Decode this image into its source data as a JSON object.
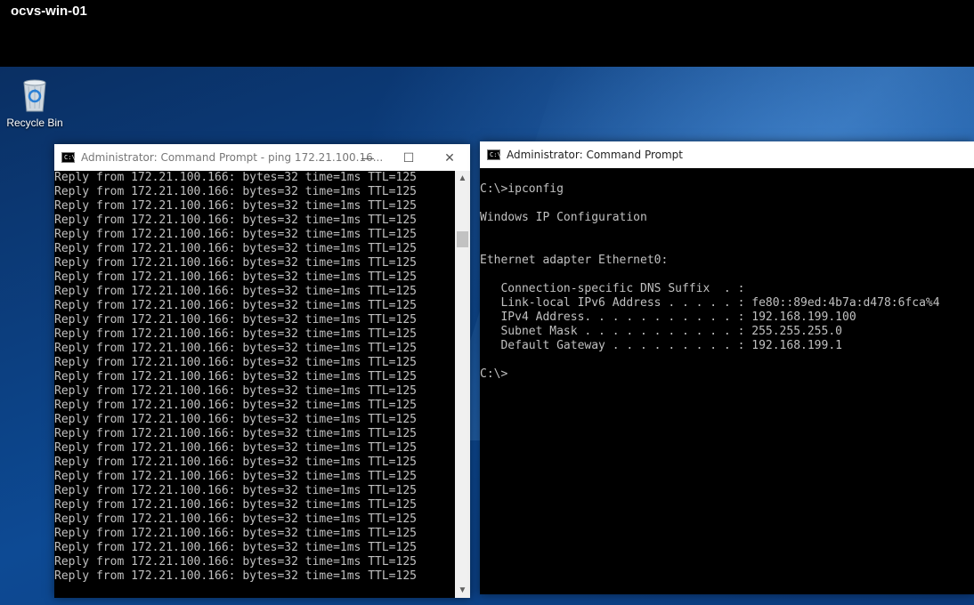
{
  "vm": {
    "name": "ocvs-win-01"
  },
  "desktop": {
    "recycle_bin": {
      "label": "Recycle Bin",
      "icon": "recycle-bin-icon"
    }
  },
  "ping_window": {
    "title": "Administrator: Command Prompt - ping  172.21.100.16...",
    "line_text": "Reply from 172.21.100.166: bytes=32 time=1ms TTL=125",
    "line_count": 29,
    "scroll_position": 0.12,
    "buttons": {
      "minimize": "—",
      "maximize": "☐",
      "close": "✕"
    }
  },
  "ipconfig_window": {
    "title": "Administrator: Command Prompt",
    "lines": [
      "C:\\>ipconfig",
      "",
      "Windows IP Configuration",
      "",
      "",
      "Ethernet adapter Ethernet0:",
      "",
      "   Connection-specific DNS Suffix  . :",
      "   Link-local IPv6 Address . . . . . : fe80::89ed:4b7a:d478:6fca%4",
      "   IPv4 Address. . . . . . . . . . . : 192.168.199.100",
      "   Subnet Mask . . . . . . . . . . . : 255.255.255.0",
      "   Default Gateway . . . . . . . . . : 192.168.199.1",
      "",
      "C:\\>"
    ]
  }
}
